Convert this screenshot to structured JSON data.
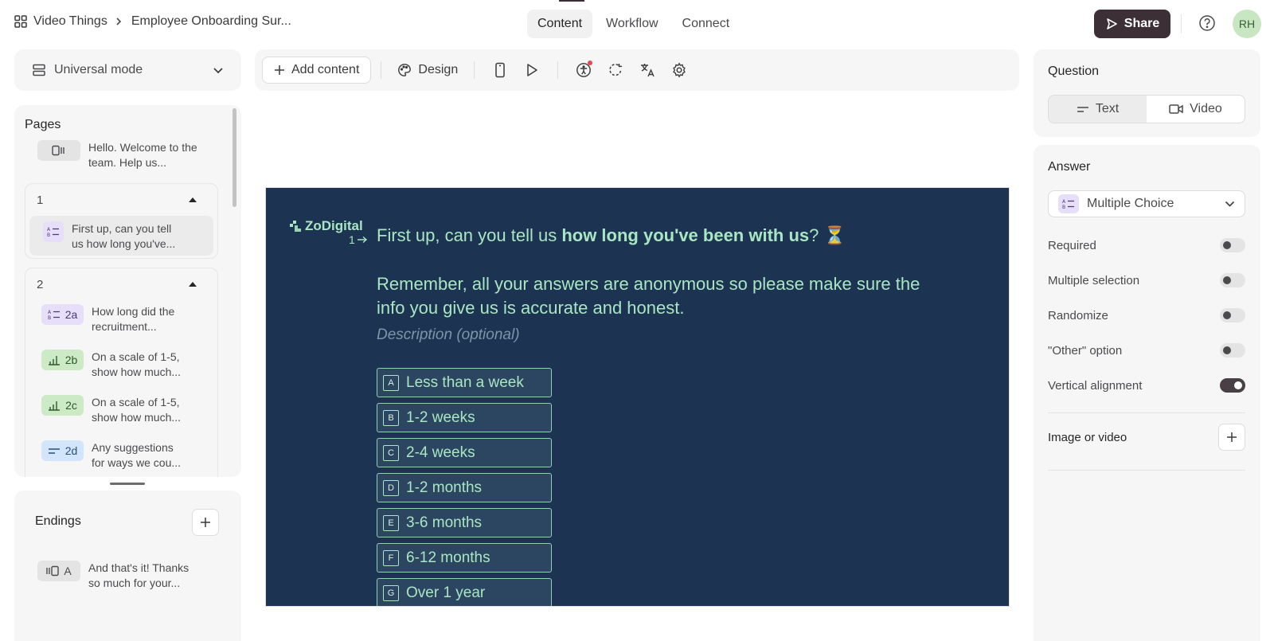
{
  "breadcrumb": {
    "workspace": "Video Things",
    "form": "Employee Onboarding Sur..."
  },
  "nav_tabs": [
    {
      "label": "Content",
      "active": true
    },
    {
      "label": "Workflow",
      "active": false
    },
    {
      "label": "Connect",
      "active": false
    }
  ],
  "header": {
    "share_label": "Share",
    "avatar_initials": "RH"
  },
  "mode": {
    "label": "Universal mode"
  },
  "toolbar": {
    "add_content_label": "Add content",
    "design_label": "Design"
  },
  "pages": {
    "title": "Pages",
    "welcome": {
      "text": "Hello. Welcome to the team. Help us..."
    },
    "groups": [
      {
        "number": "1",
        "items": [
          {
            "badge": "",
            "type": "multiple-choice",
            "text": "First up, can you tell us how long you've..."
          }
        ]
      },
      {
        "number": "2",
        "items": [
          {
            "badge": "2a",
            "type": "multiple-choice",
            "text": "How long did the recruitment..."
          },
          {
            "badge": "2b",
            "type": "opinion-scale",
            "text": "On a scale of 1-5, show how much..."
          },
          {
            "badge": "2c",
            "type": "opinion-scale",
            "text": "On a scale of 1-5, show how much..."
          },
          {
            "badge": "2d",
            "type": "text",
            "text": "Any suggestions for ways we cou..."
          }
        ]
      }
    ]
  },
  "endings": {
    "title": "Endings",
    "items": [
      {
        "badge": "A",
        "text": "And that's it! Thanks so much for your..."
      }
    ]
  },
  "canvas": {
    "logo": "ZoDigital",
    "question_number": "1",
    "title_prefix": "First up, can you tell us ",
    "title_bold": "how long you've been with us",
    "title_suffix": "? ⏳",
    "subtitle": "Remember, all your answers are anonymous so please make sure the info you give us is accurate and honest.",
    "description_placeholder": "Description (optional)",
    "options": [
      {
        "key": "A",
        "label": "Less than a week"
      },
      {
        "key": "B",
        "label": "1-2 weeks"
      },
      {
        "key": "C",
        "label": "2-4 weeks"
      },
      {
        "key": "D",
        "label": "1-2 months"
      },
      {
        "key": "E",
        "label": "3-6 months"
      },
      {
        "key": "F",
        "label": "6-12 months"
      },
      {
        "key": "G",
        "label": "Over 1 year"
      }
    ],
    "colors": {
      "background": "#1d3352",
      "accent": "#a9e6c3"
    }
  },
  "question_panel": {
    "title": "Question",
    "types": [
      {
        "label": "Text",
        "active": true
      },
      {
        "label": "Video",
        "active": false
      }
    ]
  },
  "answer_panel": {
    "title": "Answer",
    "answer_type": "Multiple Choice",
    "settings": [
      {
        "label": "Required",
        "on": false
      },
      {
        "label": "Multiple selection",
        "on": false
      },
      {
        "label": "Randomize",
        "on": false
      },
      {
        "label": "\"Other\" option",
        "on": false
      },
      {
        "label": "Vertical alignment",
        "on": true
      }
    ],
    "media_label": "Image or video"
  }
}
